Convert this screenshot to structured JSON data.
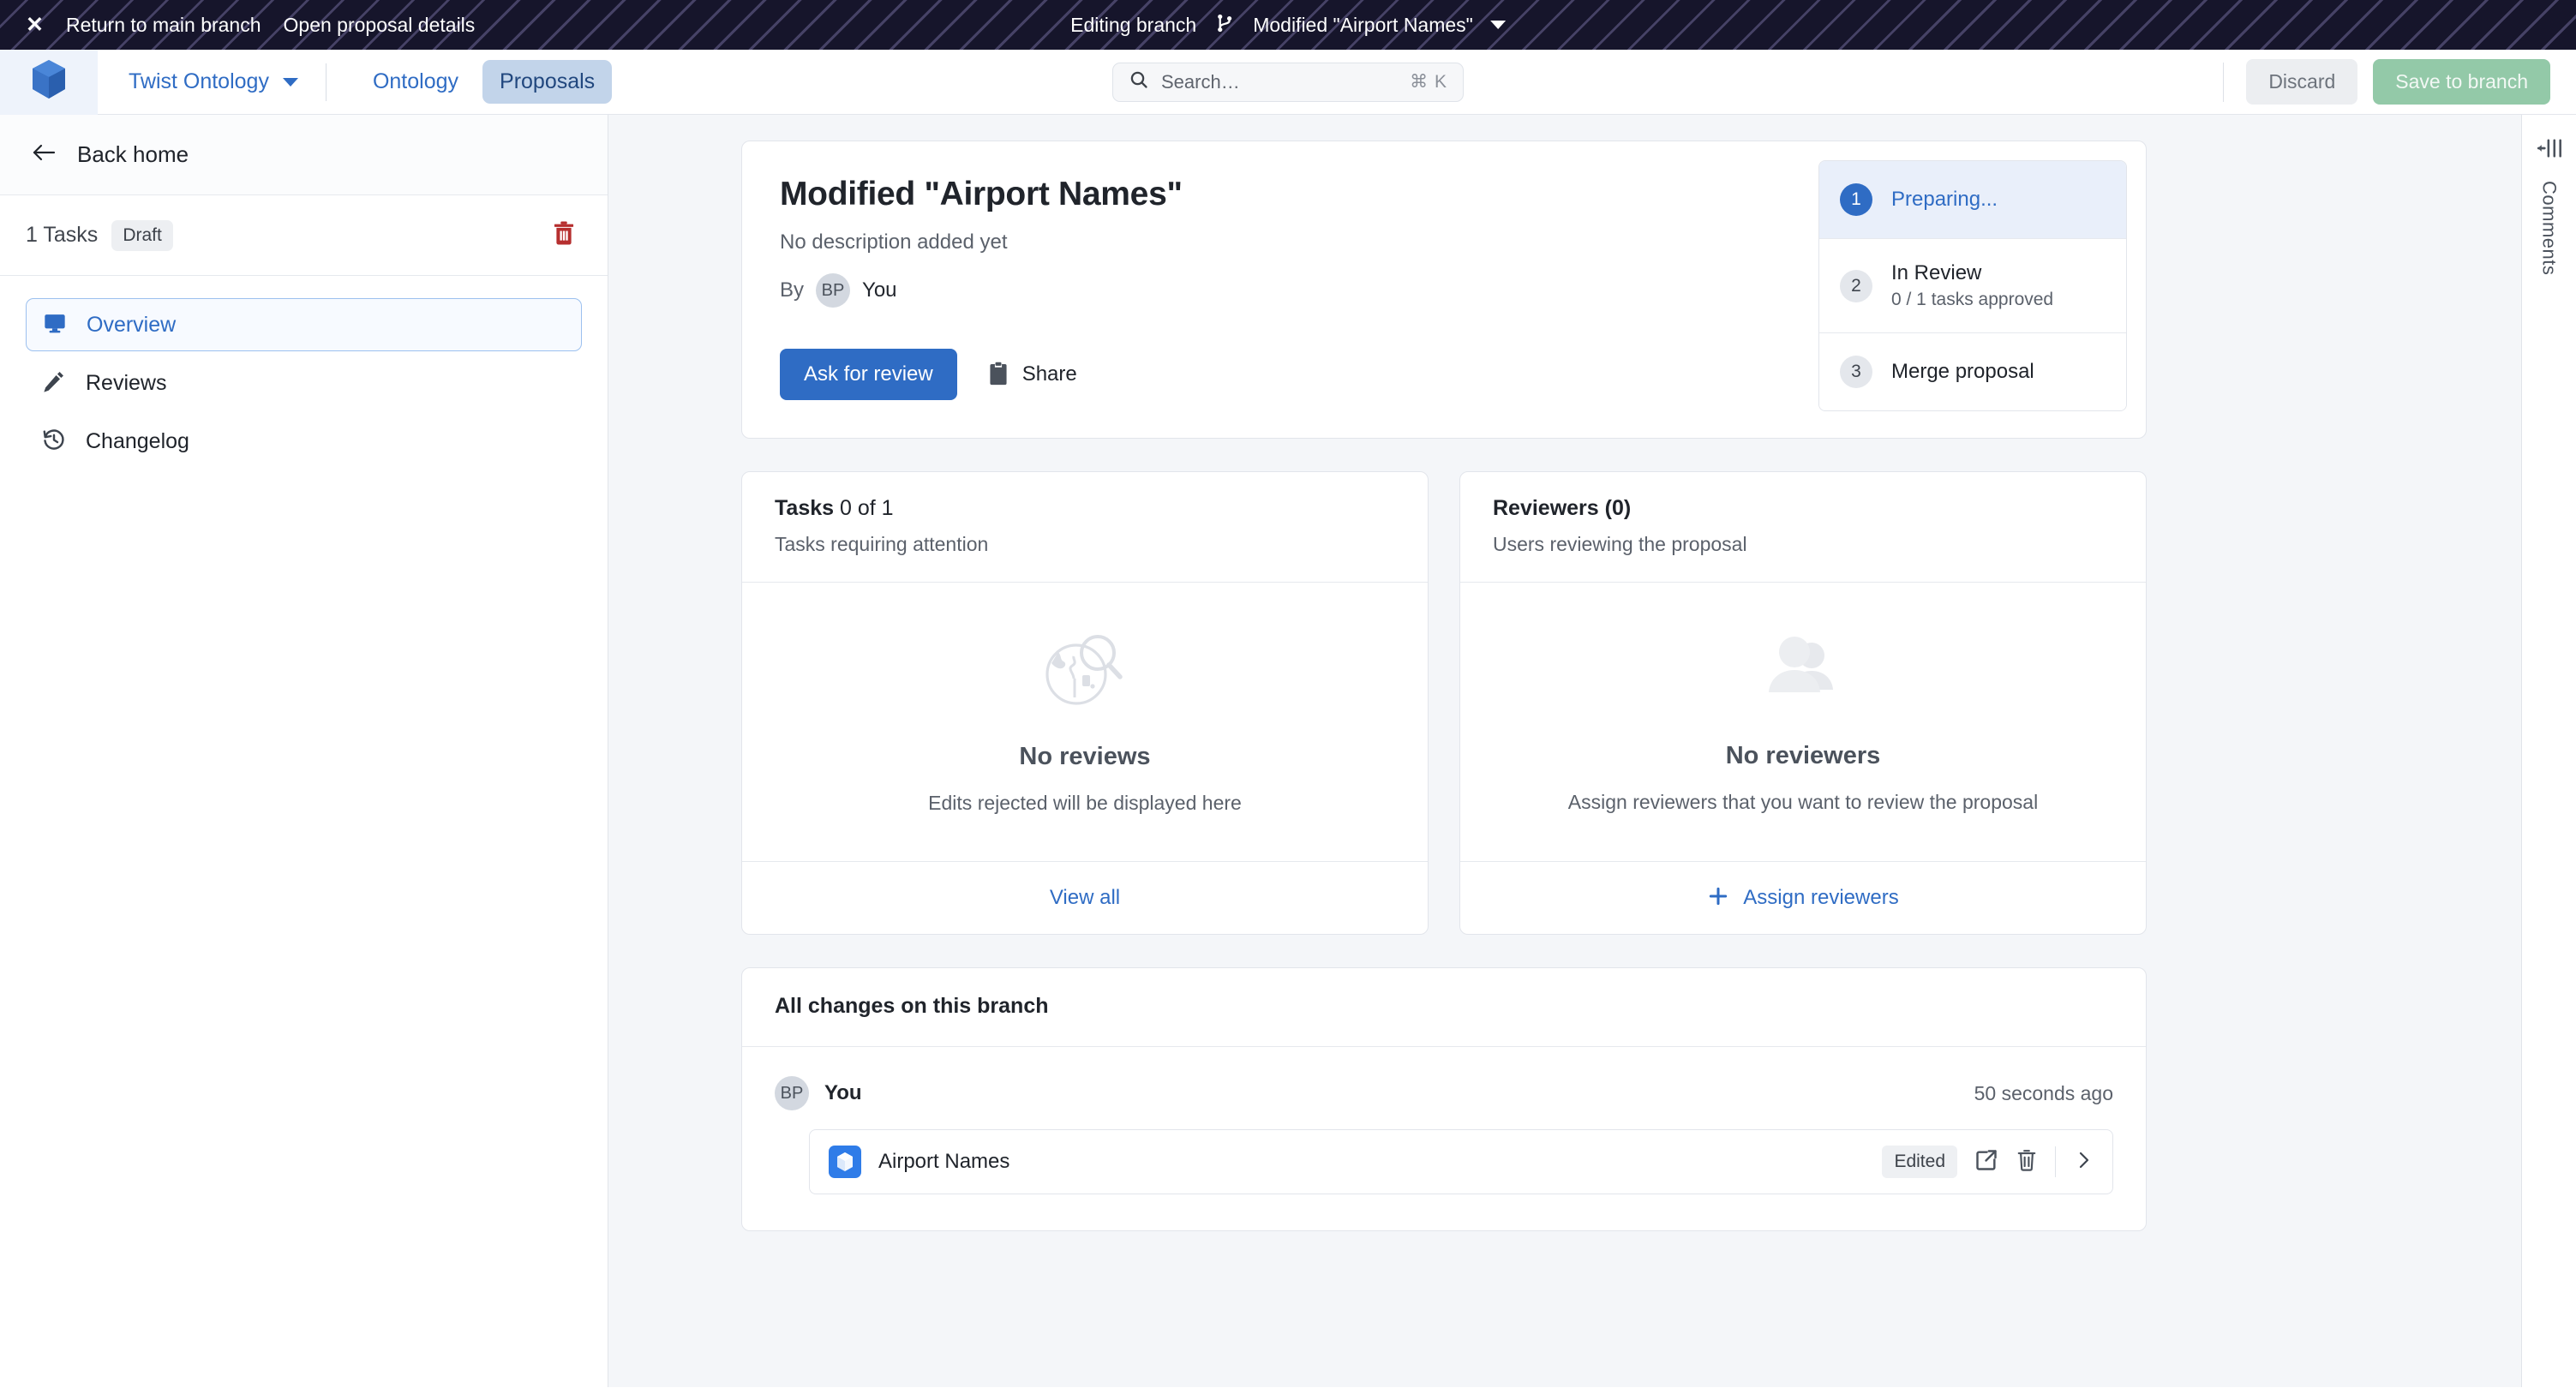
{
  "branch_bar": {
    "close_icon": "close-icon",
    "return_label": "Return to main branch",
    "details_label": "Open proposal details",
    "editing_label": "Editing branch",
    "branch_icon": "git-branch-icon",
    "branch_name": "Modified \"Airport Names\"",
    "dropdown_icon": "chevron-down-icon",
    "bg_color": "#16152b",
    "stripe_color": "#9b91cd"
  },
  "header": {
    "logo_icon": "cube-logo-icon",
    "org_name": "Twist Ontology",
    "org_caret_icon": "chevron-down-icon",
    "tabs": [
      {
        "label": "Ontology",
        "active": false
      },
      {
        "label": "Proposals",
        "active": true
      }
    ],
    "search": {
      "icon": "search-icon",
      "placeholder": "Search…",
      "value": "",
      "shortcut": "⌘ K"
    },
    "discard_label": "Discard",
    "save_label": "Save to branch",
    "accent_color": "#2f6cc4",
    "save_color": "#93c9a8"
  },
  "sidebar": {
    "back_icon": "arrow-left-icon",
    "back_label": "Back home",
    "tasks_count_label": "1 Tasks",
    "status_badge": "Draft",
    "delete_icon": "trash-icon",
    "delete_color": "#b62f2f",
    "items": [
      {
        "label": "Overview",
        "icon": "monitor-icon",
        "active": true
      },
      {
        "label": "Reviews",
        "icon": "pencil-icon",
        "active": false
      },
      {
        "label": "Changelog",
        "icon": "history-icon",
        "active": false
      }
    ]
  },
  "proposal": {
    "title": "Modified \"Airport Names\"",
    "description": "No description added yet",
    "by_label": "By",
    "author_initials": "BP",
    "author_name": "You",
    "ask_review_label": "Ask for review",
    "share_icon": "clipboard-icon",
    "share_label": "Share"
  },
  "stepper": {
    "steps": [
      {
        "num": "1",
        "title": "Preparing...",
        "subtitle": "",
        "active": true
      },
      {
        "num": "2",
        "title": "In Review",
        "subtitle": "0 / 1 tasks approved",
        "active": false
      },
      {
        "num": "3",
        "title": "Merge proposal",
        "subtitle": "",
        "active": false
      }
    ]
  },
  "tasks_card": {
    "title_bold": "Tasks",
    "title_rest": "0 of 1",
    "subtitle": "Tasks requiring attention",
    "empty_icon": "globe-search-icon",
    "empty_title": "No reviews",
    "empty_subtitle": "Edits rejected will be displayed here",
    "footer_label": "View all"
  },
  "reviewers_card": {
    "title_bold": "Reviewers (0)",
    "subtitle": "Users reviewing the proposal",
    "empty_icon": "users-icon",
    "empty_title": "No reviewers",
    "empty_subtitle": "Assign reviewers that you want to review the proposal",
    "footer_icon": "plus-icon",
    "footer_label": "Assign reviewers"
  },
  "changes": {
    "title": "All changes on this branch",
    "author_initials": "BP",
    "author_name": "You",
    "timestamp": "50 seconds ago",
    "item": {
      "icon": "cube-icon",
      "name": "Airport Names",
      "badge": "Edited",
      "open_icon": "external-link-icon",
      "delete_icon": "trash-icon",
      "chevron_icon": "chevron-right-icon"
    }
  },
  "comments_rail": {
    "icon": "panel-collapse-icon",
    "label": "Comments"
  }
}
